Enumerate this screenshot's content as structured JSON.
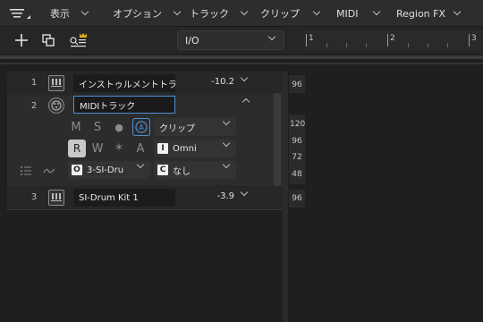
{
  "menubar": {
    "items": [
      {
        "label": "表示"
      },
      {
        "label": "オプション"
      },
      {
        "label": "トラック"
      },
      {
        "label": "クリップ"
      },
      {
        "label": "MIDI"
      },
      {
        "label": "Region FX"
      }
    ]
  },
  "toolbar": {
    "add_icon": "plus-icon",
    "duplicate_icon": "duplicate-icon",
    "track_settings_icon": "crown-list-icon",
    "io_select": {
      "value": "I/O"
    }
  },
  "ruler": {
    "markers": [
      "1",
      "2",
      "3"
    ]
  },
  "tracks": [
    {
      "number": "1",
      "name": "インストゥルメントトラック",
      "volume": "-10.2",
      "icon": "keyboard-icon"
    },
    {
      "number": "2",
      "name": "MIDIトラック",
      "icon": "midi-icon",
      "controls": {
        "mute": "M",
        "solo": "S",
        "record": "●",
        "automation": "A",
        "read": "R",
        "write": "W",
        "star": "*",
        "auto_a": "A"
      },
      "input_type": "クリップ",
      "input_port": "Omni",
      "input_port_badge": "I",
      "output": "3-SI-Dru",
      "output_badge": "O",
      "channel": "なし",
      "channel_badge": "C"
    },
    {
      "number": "3",
      "name": "SI-Drum Kit 1",
      "volume": "-3.9",
      "icon": "keyboard-icon"
    }
  ],
  "velocity": {
    "track1": [
      "96"
    ],
    "track2": [
      "120",
      "96",
      "72",
      "48"
    ],
    "track3": [
      "96"
    ]
  }
}
